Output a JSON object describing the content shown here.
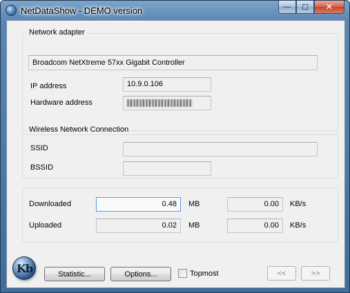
{
  "window": {
    "title": "NetDataShow - DEMO version",
    "controls": {
      "minimize": "—",
      "maximize": "☐",
      "close": "✕"
    }
  },
  "network_adapter": {
    "group_title": "Network adapter",
    "adapter_name": "Broadcom NetXtreme 57xx Gigabit Controller",
    "ip_label": "IP address",
    "ip_value": "10.9.0.106",
    "hw_label": "Hardware address"
  },
  "wireless": {
    "group_title": "Wireless Network Connection",
    "ssid_label": "SSID",
    "ssid_value": "",
    "bssid_label": "BSSID",
    "bssid_value": ""
  },
  "stats": {
    "downloaded_label": "Downloaded",
    "downloaded_value": "0.48",
    "downloaded_unit": "MB",
    "download_rate": "0.00",
    "download_rate_unit": "KB/s",
    "uploaded_label": "Uploaded",
    "uploaded_value": "0.02",
    "uploaded_unit": "MB",
    "upload_rate": "0.00",
    "upload_rate_unit": "KB/s"
  },
  "bottom": {
    "logo_text": "Kb",
    "statistic_button": "Statistic...",
    "options_button": "Options...",
    "topmost_label": "Topmost",
    "prev_button": "<<",
    "next_button": ">>"
  }
}
